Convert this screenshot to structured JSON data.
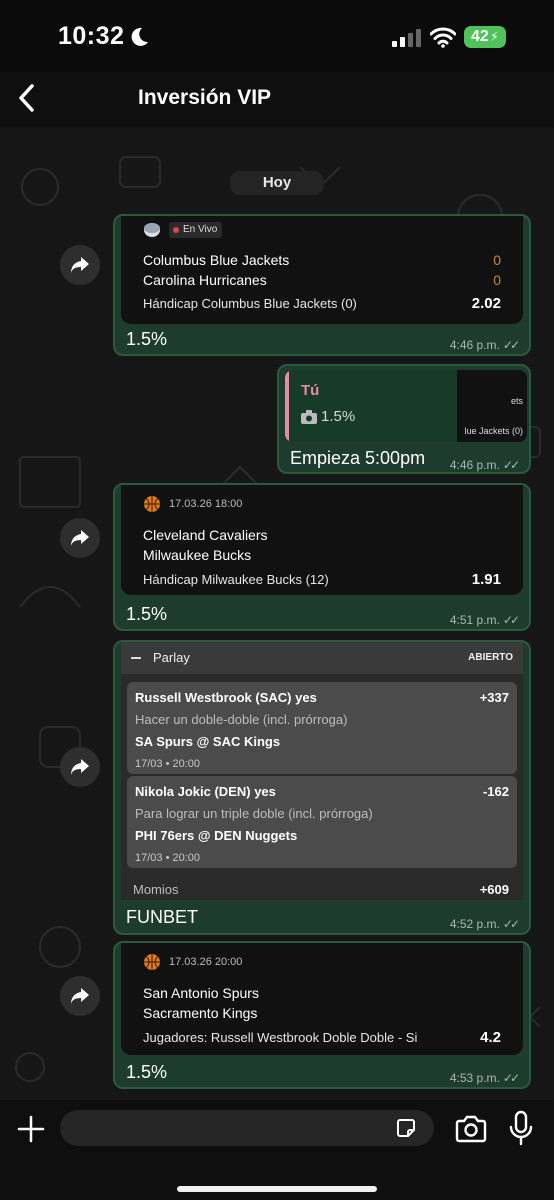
{
  "status": {
    "time": "10:32",
    "battery": "42"
  },
  "header": {
    "title": "Inversión VIP"
  },
  "chat": {
    "day": "Hoy",
    "msg1": {
      "live": "En Vivo",
      "team1": "Columbus Blue Jackets",
      "score1": "0",
      "team2": "Carolina Hurricanes",
      "score2": "0",
      "market": "Hándicap Columbus Blue Jackets (0)",
      "odd": "2.02",
      "caption": "1.5%",
      "time": "4:46 p.m."
    },
    "msg2": {
      "reply_author": "Tú",
      "reply_text": "1.5%",
      "thumb_line1": "ets",
      "thumb_line2": "lue Jackets (0)",
      "text": "Empieza 5:00pm",
      "time": "4:46 p.m."
    },
    "msg3": {
      "date": "17.03.26 18:00",
      "team1": "Cleveland Cavaliers",
      "team2": "Milwaukee Bucks",
      "market": "Hándicap Milwaukee Bucks (12)",
      "odd": "1.91",
      "caption": "1.5%",
      "time": "4:51 p.m."
    },
    "msg4": {
      "title": "Parlay",
      "status": "ABIERTO",
      "legs": [
        {
          "player": "Russell Westbrook (SAC) yes",
          "odd": "+337",
          "market": "Hacer un doble-doble (incl. prórroga)",
          "match": "SA Spurs @ SAC Kings",
          "date": "17/03 • 20:00"
        },
        {
          "player": "Nikola Jokic (DEN) yes",
          "odd": "-162",
          "market": "Para lograr un triple doble (incl. prórroga)",
          "match": "PHI 76ers @ DEN Nuggets",
          "date": "17/03 • 20:00"
        }
      ],
      "momios_label": "Momios",
      "momios_value": "+609",
      "caption": "FUNBET",
      "time": "4:52 p.m."
    },
    "msg5": {
      "date": "17.03.26 20:00",
      "team1": "San Antonio Spurs",
      "team2": "Sacramento Kings",
      "market": "Jugadores: Russell Westbrook Doble Doble - Si",
      "odd": "4.2",
      "caption": "1.5%",
      "time": "4:53 p.m."
    }
  },
  "input": {
    "placeholder": ""
  },
  "colors": {
    "bubble": "#1e3c2d",
    "bubble_border": "#2a5a3e",
    "reply_accent": "#e58ca2",
    "battery": "#4fc25a",
    "live_dot": "#e0454a"
  }
}
